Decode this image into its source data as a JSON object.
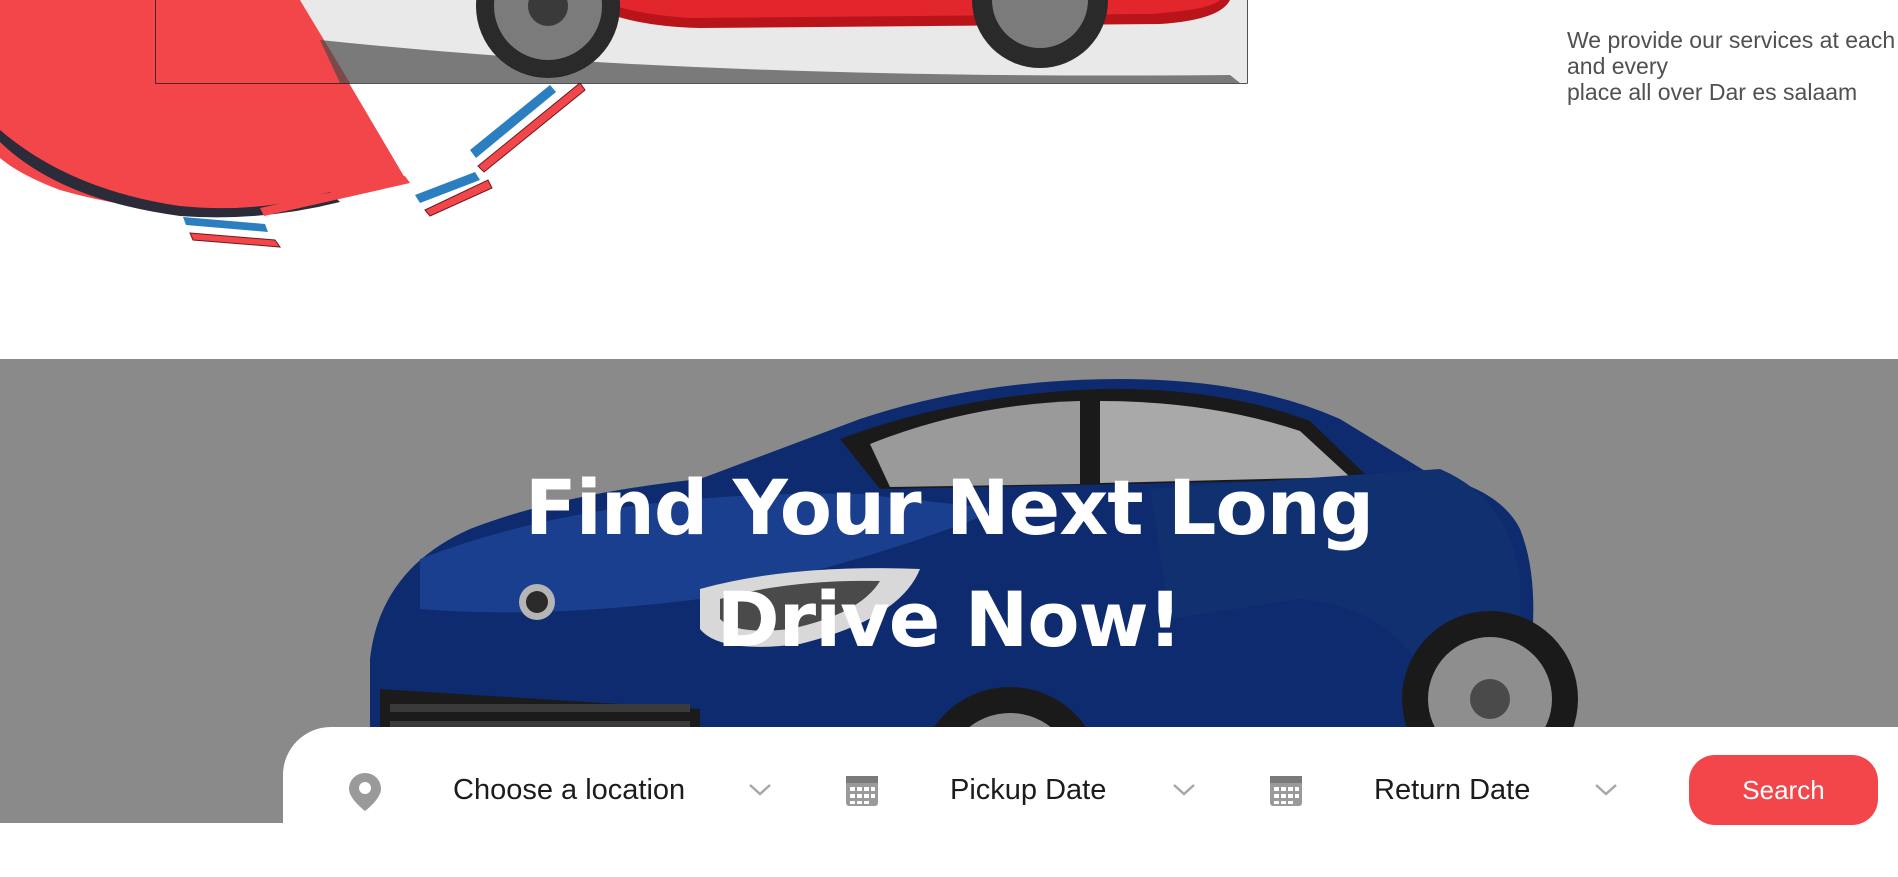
{
  "services": {
    "line1": "We provide our services at each",
    "line2": "and every",
    "line3": "place all over Dar es salaam"
  },
  "hero": {
    "title_line1": "Find Your Next Long",
    "title_line2": "Drive Now!"
  },
  "search": {
    "location_label": "Choose a location",
    "pickup_label": "Pickup Date",
    "return_label": "Return Date",
    "button_label": "Search"
  },
  "icons": {
    "location": "map-pin-icon",
    "pickup": "calendar-icon",
    "return": "calendar-icon",
    "dropdown": "chevron-down-icon"
  },
  "colors": {
    "accent": "#f2464b",
    "hero_bg": "#8a8a8a",
    "car_blue": "#0b2a6b",
    "car_red": "#d11a20"
  }
}
